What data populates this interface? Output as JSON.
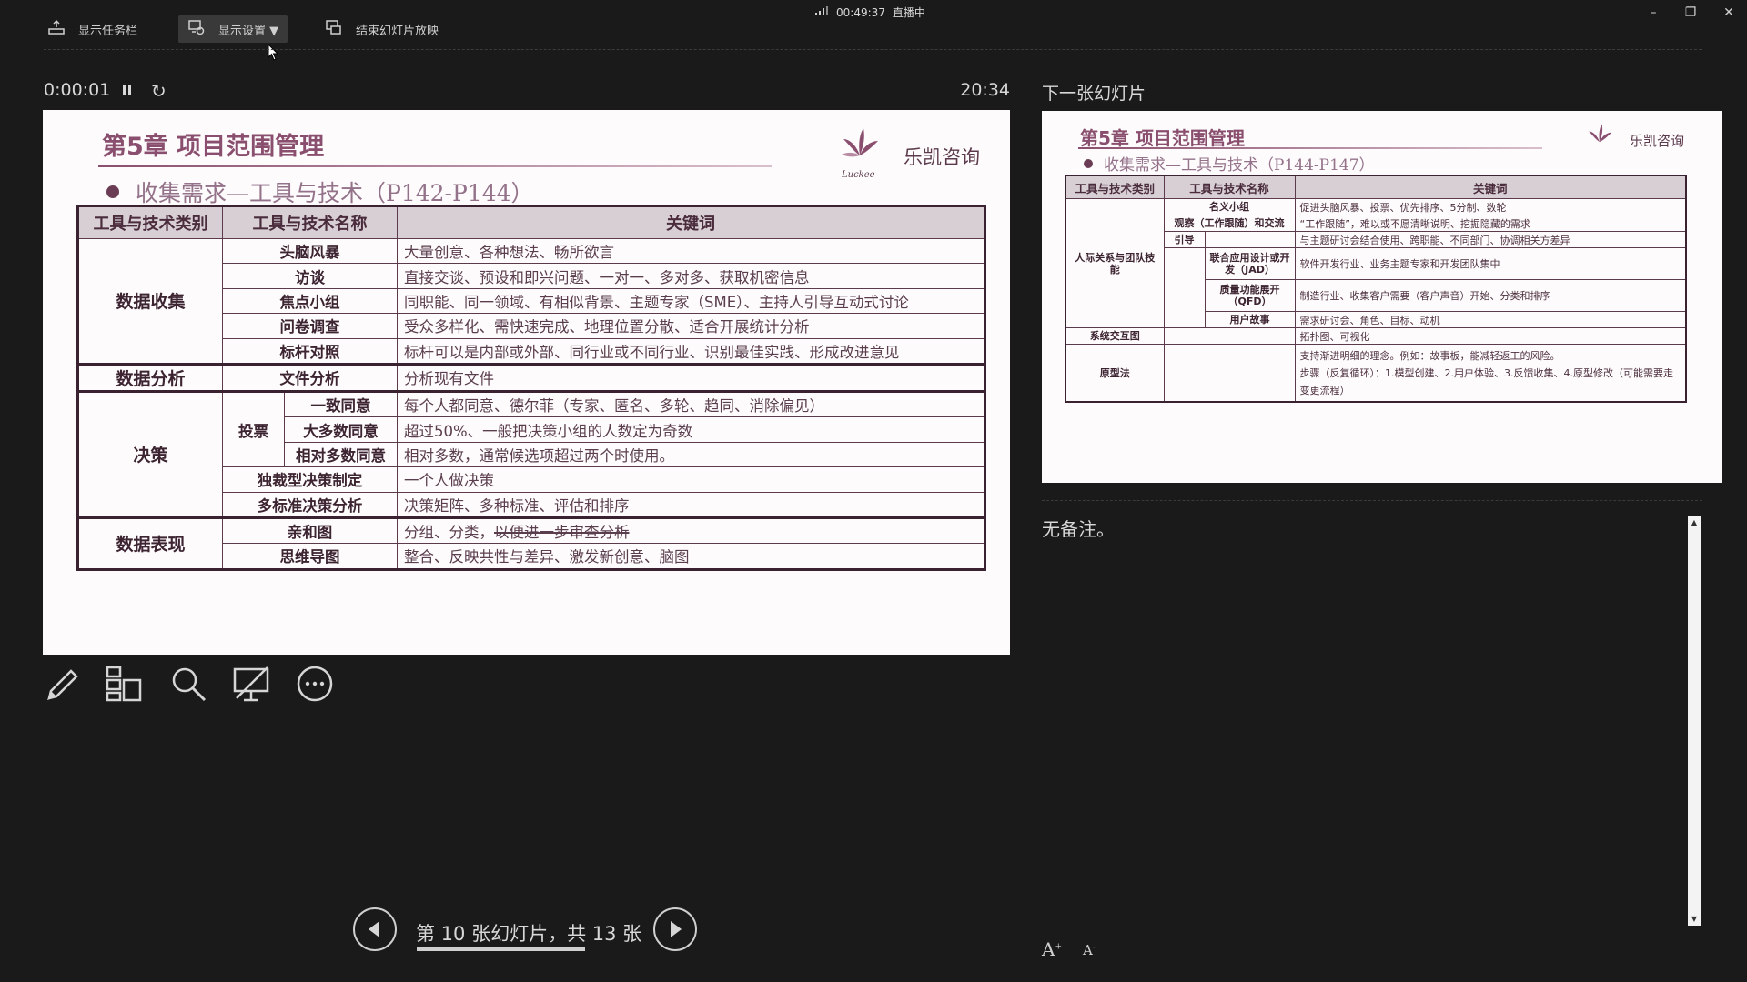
{
  "topbar": {
    "show_taskbar": "显示任务栏",
    "display_settings": "显示设置 ▼",
    "end_show": "结束幻灯片放映",
    "clock_time": "00:49:37",
    "live_status": "直播中"
  },
  "timer": {
    "elapsed": "0:00:01",
    "clock": "20:34"
  },
  "slide": {
    "title": "第5章 项目范围管理",
    "subtitle": "收集需求—工具与技术（P142-P144）",
    "logo_text": "乐凯咨询",
    "logo_small": "Luckee",
    "headers": [
      "工具与技术类别",
      "工具与技术名称",
      "关键词"
    ],
    "groups": {
      "data_collection": "数据收集",
      "data_analysis": "数据分析",
      "decision": "决策",
      "voting": "投票",
      "data_representation": "数据表现"
    },
    "rows": [
      {
        "name": "头脑风暴",
        "keyword": "大量创意、各种想法、畅所欲言"
      },
      {
        "name": "访谈",
        "keyword": "直接交谈、预设和即兴问题、一对一、多对多、获取机密信息"
      },
      {
        "name": "焦点小组",
        "keyword": "同职能、同一领域、有相似背景、主题专家（SME）、主持人引导互动式讨论"
      },
      {
        "name": "问卷调查",
        "keyword": "受众多样化、需快速完成、地理位置分散、适合开展统计分析"
      },
      {
        "name": "标杆对照",
        "keyword": "标杆可以是内部或外部、同行业或不同行业、识别最佳实践、形成改进意见"
      },
      {
        "name": "文件分析",
        "keyword": "分析现有文件"
      },
      {
        "name": "一致同意",
        "keyword": "每个人都同意、德尔菲（专家、匿名、多轮、趋同、消除偏见）"
      },
      {
        "name": "大多数同意",
        "keyword": "超过50%、一般把决策小组的人数定为奇数"
      },
      {
        "name": "相对多数同意",
        "keyword": "相对多数，通常候选项超过两个时使用。"
      },
      {
        "name": "独裁型决策制定",
        "keyword": "一个人做决策"
      },
      {
        "name": "多标准决策分析",
        "keyword": "决策矩阵、多种标准、评估和排序"
      },
      {
        "name": "亲和图",
        "keyword": "分组、分类，",
        "keyword_struck": "以便进一步审查分析"
      },
      {
        "name": "思维导图",
        "keyword": "整合、反映共性与差异、激发新创意、脑图"
      }
    ]
  },
  "next_slide": {
    "label": "下一张幻灯片",
    "title": "第5章 项目范围管理",
    "subtitle": "收集需求—工具与技术（P144-P147）",
    "logo_text": "乐凯咨询",
    "logo_small": "Luckee",
    "headers": [
      "工具与技术类别",
      "工具与技术名称",
      "关键词"
    ],
    "group_interpersonal": "人际关系与团队技能",
    "group_system": "系统交互图",
    "group_prototype": "原型法",
    "sub_guide": "引导",
    "rows": [
      {
        "name": "名义小组",
        "keyword": "促进头脑风暴、投票、优先排序、5分制、数轮"
      },
      {
        "name": "观察（工作跟随）和交流",
        "keyword": "“工作跟随”，难以或不愿清晰说明、挖掘隐藏的需求"
      },
      {
        "name": "",
        "keyword": "与主题研讨会结合使用、跨职能、不同部门、协调相关方差异"
      },
      {
        "name": "联合应用设计或开发（JAD）",
        "keyword": "软件开发行业、业务主题专家和开发团队集中"
      },
      {
        "name": "质量功能展开（QFD）",
        "keyword": "制造行业、收集客户需要（客户声音）开始、分类和排序"
      },
      {
        "name": "用户故事",
        "keyword": "需求研讨会、角色、目标、动机"
      },
      {
        "name": "",
        "keyword": "拓扑图、可视化"
      },
      {
        "name": "",
        "keyword": "支持渐进明细的理念。例如：故事板，能减轻返工的风险。",
        "keyword2": "步骤（反复循环）：1.模型创建、2.用户体验、3.反馈收集、4.原型修改（可能需要走变更流程）"
      }
    ]
  },
  "nav": {
    "label": "第 10 张幻灯片，共 13 张"
  },
  "notes": {
    "text": "无备注。"
  },
  "font_controls": {
    "increase": "A",
    "decrease": "A"
  },
  "colors": {
    "background": "#1b1a1a",
    "slide_title": "#8a4f6e",
    "table_header": "#d8cfd4"
  }
}
